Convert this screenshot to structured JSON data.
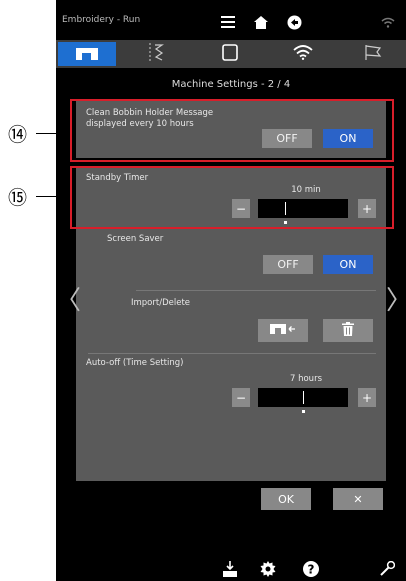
{
  "status_bar": {
    "app_title": "Embroidery - Run"
  },
  "icons": {
    "menu": "hamburger-menu-icon",
    "home": "home-icon",
    "exit": "exit-icon",
    "wifi": "wifi-icon",
    "sewing": "sewing-machine-icon",
    "stitch": "stitch-settings-icon",
    "embroidery": "embroidery-frame-icon",
    "network": "wireless-icon",
    "flag": "flag-icon"
  },
  "page_title": "Machine Settings - 2 / 4",
  "settings": {
    "bobbin_message": {
      "label": "Clean Bobbin Holder Message\ndisplayed every 10 hours",
      "off": "OFF",
      "on": "ON",
      "selected": "ON"
    },
    "standby_timer": {
      "label": "Standby Timer",
      "value": "10 min",
      "minus": "−",
      "plus": "+"
    },
    "screen_saver": {
      "label": "Screen Saver",
      "off": "OFF",
      "on": "ON",
      "selected": "ON"
    },
    "import_delete": {
      "label": "Import/Delete"
    },
    "auto_off": {
      "label": "Auto-off (Time Setting)",
      "value": "7 hours",
      "minus": "−",
      "plus": "+"
    }
  },
  "nav": {
    "prev": "〈",
    "next": "〉"
  },
  "footer": {
    "ok": "OK",
    "close": "✕"
  },
  "callouts": {
    "c14": "⑭",
    "c15": "⑮"
  },
  "colors": {
    "accent": "#2b63c8",
    "tab_active": "#1e6fd1",
    "panel": "#5a5a5a",
    "callout": "#d81e2a"
  }
}
